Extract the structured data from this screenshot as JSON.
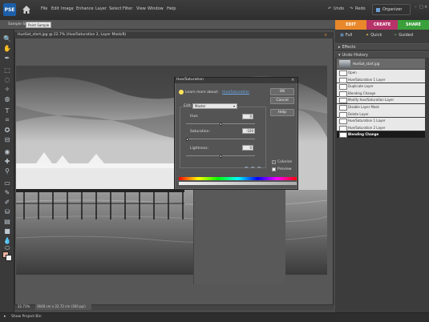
{
  "app": {
    "logo": "PSE",
    "menu": [
      "File",
      "Edit",
      "Image",
      "Enhance",
      "Layer",
      "Select",
      "Filter",
      "View",
      "Window",
      "Help"
    ],
    "undo_label": "Undo",
    "redo_label": "Redo",
    "organizer_label": "Organizer"
  },
  "tabs": [
    {
      "label": "EDIT",
      "color": "#e8882a"
    },
    {
      "label": "CREATE",
      "color": "#b8336a"
    },
    {
      "label": "SHARE",
      "color": "#3aa03a"
    }
  ],
  "options_bar": {
    "sample_size_label": "Sample Size:",
    "sample_size_value": "Point Sample"
  },
  "document": {
    "title": "HueSat_start.jpg @ 22.7% (Hue/Saturation 2, Layer Mask/8)",
    "zoom": "22.71%",
    "doc_size": "3648 cm x 22.72 cm (300 ppi)"
  },
  "right_panel": {
    "modes": [
      "Full",
      "Quick",
      "Guided"
    ],
    "effects_label": "Effects",
    "history_label": "Undo History",
    "history_items": [
      "HueSat_start.jpg",
      "Open",
      "Hue/Saturation 1 Layer",
      "Duplicate Layer",
      "Blending Change",
      "Modify Hue/Saturation Layer",
      "Disable Layer Mask",
      "Delete Layer",
      "Hue/Saturation 1 Layer",
      "Hue/Saturation 2 Layer",
      "Blending Change"
    ],
    "selected_index": 10
  },
  "dialog": {
    "title": "Hue/Saturation",
    "learn_label": "Learn more about:",
    "learn_link": "Hue/Saturation",
    "ok": "OK",
    "cancel": "Cancel",
    "help": "Help",
    "edit_label": "Edit:",
    "edit_value": "Master",
    "hue_label": "Hue:",
    "hue_value": "0",
    "saturation_label": "Saturation:",
    "saturation_value": "-100",
    "lightness_label": "Lightness:",
    "lightness_value": "0",
    "colorize_label": "Colorize",
    "colorize_checked": false,
    "preview_label": "Preview",
    "preview_checked": true
  },
  "project_bin": {
    "label": "Show Project Bin"
  }
}
